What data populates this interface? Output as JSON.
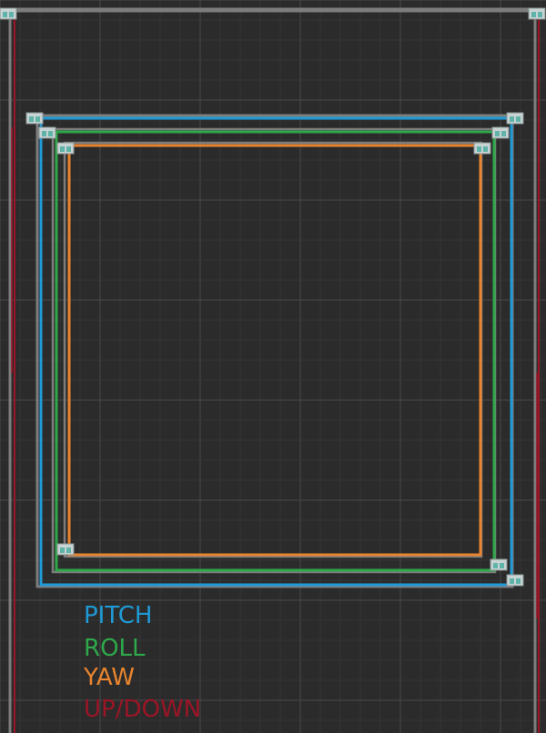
{
  "colors": {
    "background": "#2b2b2b",
    "grid_minor": "#353535",
    "grid_major": "#4a4a4a",
    "frame_gray": "#7d7d7d",
    "pitch": "#1f9ad6",
    "roll": "#2ea84a",
    "yaw": "#e8842e",
    "updown": "#9b1526",
    "handle_fill": "#c9d3d3",
    "handle_accent": "#5fb3a8"
  },
  "legend": [
    {
      "key": "pitch",
      "label": "PITCH",
      "color": "#1f9ad6"
    },
    {
      "key": "roll",
      "label": "ROLL",
      "color": "#2ea84a"
    },
    {
      "key": "yaw",
      "label": "YAW",
      "color": "#e8842e"
    },
    {
      "key": "updown",
      "label": "UP/DOWN",
      "color": "#9b1526"
    }
  ],
  "handle_icon": "corner-handle-icon"
}
